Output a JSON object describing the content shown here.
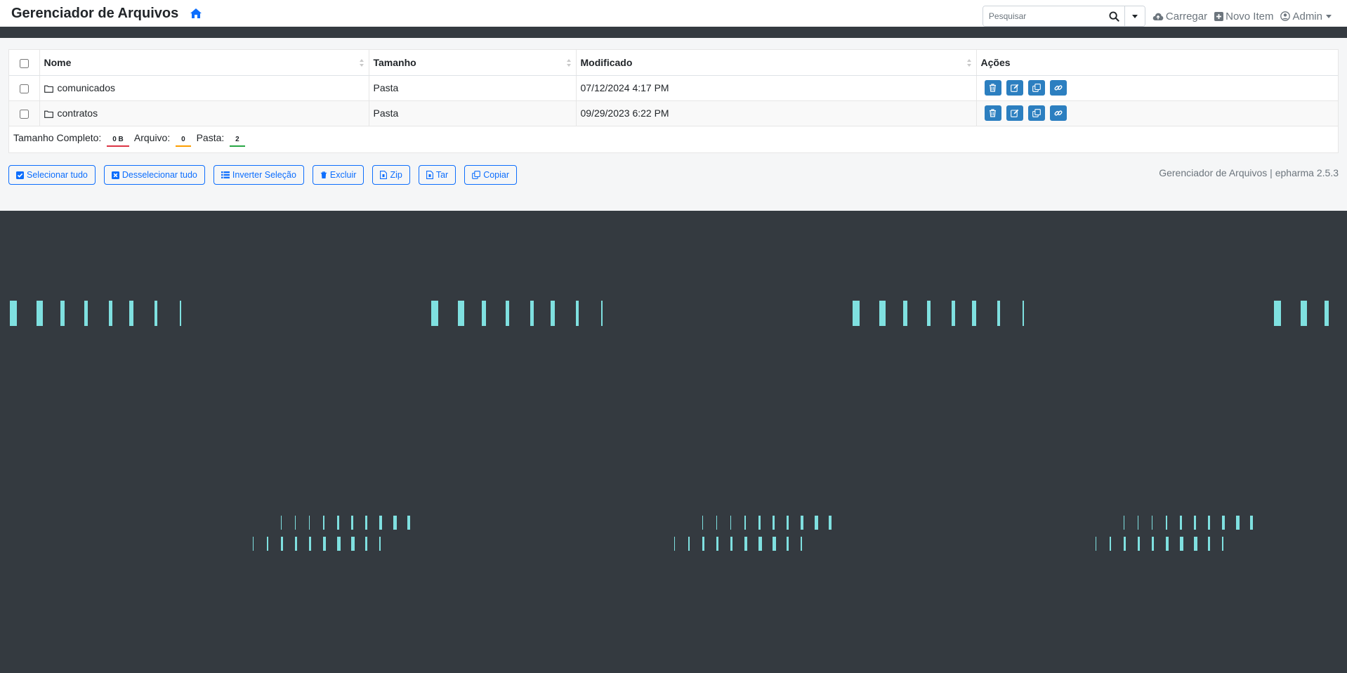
{
  "navbar": {
    "brand": "Gerenciador de Arquivos",
    "search_placeholder": "Pesquisar",
    "upload_label": "Carregar",
    "new_item_label": "Novo Item",
    "user_label": "Admin"
  },
  "table": {
    "headers": {
      "name": "Nome",
      "size": "Tamanho",
      "modified": "Modificado",
      "actions": "Ações"
    },
    "rows": [
      {
        "name": "comunicados",
        "size": "Pasta",
        "modified": "07/12/2024 4:17 PM"
      },
      {
        "name": "contratos",
        "size": "Pasta",
        "modified": "09/29/2023 6:22 PM"
      }
    ],
    "summary": {
      "total_label": "Tamanho Completo:",
      "total_value": "0 B",
      "files_label": "Arquivo:",
      "files_value": "0",
      "folders_label": "Pasta:",
      "folders_value": "2"
    }
  },
  "buttons": {
    "select_all": "Selecionar tudo",
    "deselect_all": "Desselecionar tudo",
    "invert": "Inverter Seleção",
    "delete": "Excluir",
    "zip": "Zip",
    "tar": "Tar",
    "copy": "Copiar"
  },
  "footer": {
    "text": "Gerenciador de Arquivos | epharma 2.5.3"
  },
  "colors": {
    "accent": "#0d6efd",
    "action": "#2c7fc0",
    "dark": "#343a40",
    "decor": "#7fe0e0"
  }
}
